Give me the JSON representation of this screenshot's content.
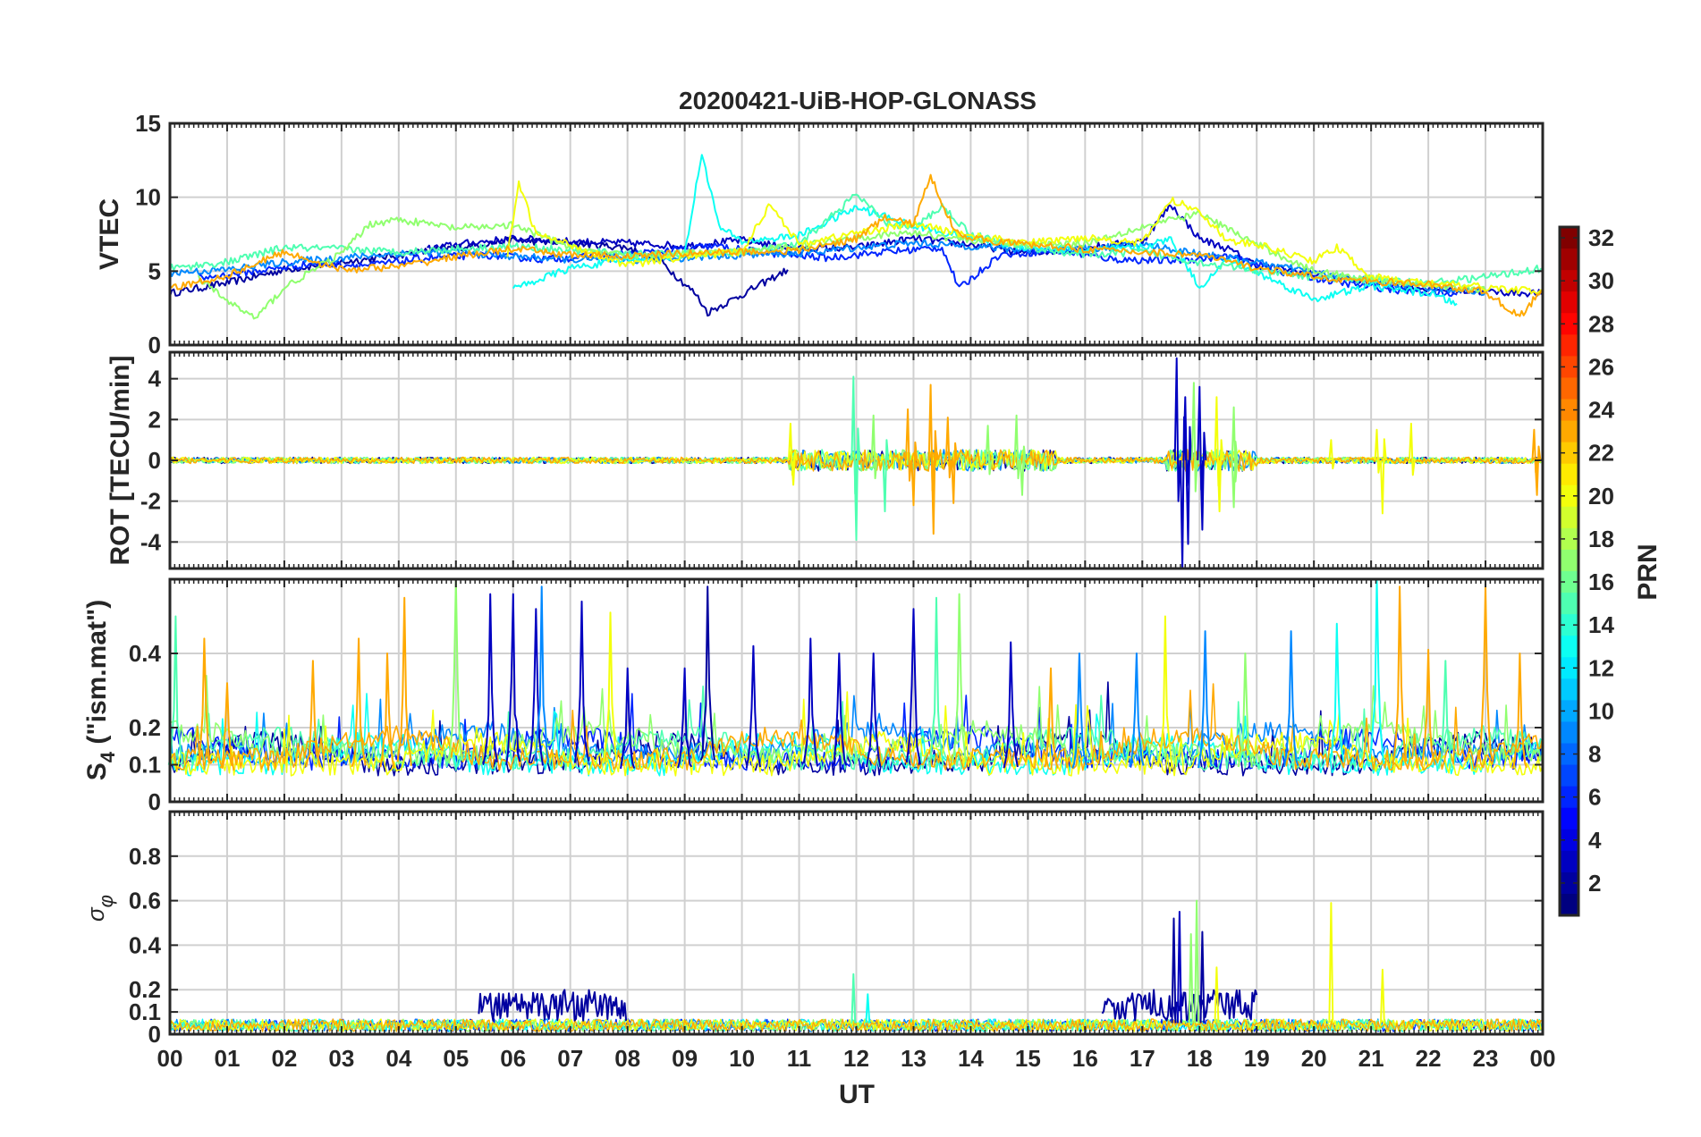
{
  "figure_title": "20200421-UiB-HOP-GLONASS",
  "colors": {
    "colormap": "jet",
    "grid": "#d0d0d0",
    "axes": "#262626",
    "background": "#ffffff"
  },
  "chart_data": [
    {
      "type": "line",
      "panel": "VTEC",
      "title": "20200421-UiB-HOP-GLONASS",
      "ylabel": "VTEC",
      "xlabel": "",
      "xlim": [
        0,
        24
      ],
      "ylim": [
        0,
        15
      ],
      "yticks": [
        0,
        5,
        10,
        15
      ],
      "xticks": [
        "00",
        "01",
        "02",
        "03",
        "04",
        "05",
        "06",
        "07",
        "08",
        "09",
        "10",
        "11",
        "12",
        "13",
        "14",
        "15",
        "16",
        "17",
        "18",
        "19",
        "20",
        "21",
        "22",
        "23",
        "00"
      ],
      "grid": true,
      "colorby": "PRN",
      "series": [
        {
          "prn": 2,
          "x": [
            0,
            1,
            2,
            3,
            4,
            5,
            6,
            7,
            8,
            8.6,
            9.2,
            9.4,
            10,
            10.8
          ],
          "y": [
            3.5,
            4.2,
            5.1,
            5.6,
            6.1,
            6.6,
            7.1,
            6.9,
            6.6,
            5.6,
            3.4,
            2.2,
            3.4,
            5.1
          ]
        },
        {
          "prn": 3,
          "x": [
            4.5,
            5,
            6,
            7,
            8,
            9,
            10,
            11,
            12,
            13,
            14,
            15,
            16,
            17,
            17.5,
            18,
            18.5,
            19,
            20,
            21,
            22,
            23,
            24
          ],
          "y": [
            6.5,
            6.8,
            7.2,
            7.0,
            6.9,
            6.7,
            7.1,
            6.5,
            6.6,
            7.2,
            6.8,
            6.2,
            6.6,
            7.0,
            9.5,
            7.2,
            6.5,
            5.4,
            4.8,
            4.2,
            3.8,
            3.6,
            3.5
          ]
        },
        {
          "prn": 6,
          "x": [
            0.5,
            1.5,
            2.5,
            3.5,
            4.5,
            5.5,
            6.5,
            7.5,
            8.5,
            9.5,
            10.5,
            11.5,
            12.5,
            13.5,
            13.8,
            14.5,
            15.5,
            16.5,
            17.5,
            18.5,
            19.5,
            20.5,
            21.5,
            22.5
          ],
          "y": [
            4.5,
            5.0,
            5.5,
            5.4,
            5.9,
            6.1,
            5.8,
            6.0,
            6.3,
            6.7,
            6.2,
            5.9,
            6.3,
            6.6,
            3.8,
            6.1,
            6.4,
            5.8,
            5.7,
            6.0,
            4.9,
            4.2,
            3.7,
            3.4
          ]
        },
        {
          "prn": 9,
          "x": [
            0,
            1,
            2,
            3,
            4,
            5,
            6,
            7,
            8,
            9,
            10,
            11,
            12,
            13,
            14,
            15,
            16,
            17,
            18,
            19,
            20,
            21,
            22,
            23
          ],
          "y": [
            4.9,
            5.1,
            5.6,
            5.9,
            6.2,
            6.3,
            6.0,
            5.8,
            5.7,
            5.9,
            6.1,
            6.2,
            6.6,
            6.9,
            6.7,
            6.4,
            6.5,
            6.8,
            6.2,
            5.6,
            4.9,
            4.3,
            3.9,
            3.6
          ]
        },
        {
          "prn": 13,
          "x": [
            6,
            6.5,
            7,
            8,
            9,
            9.3,
            9.6,
            10,
            11,
            12,
            13,
            14,
            15,
            16,
            17,
            17.5,
            18,
            18.5,
            19,
            20,
            21,
            22,
            22.5
          ],
          "y": [
            3.8,
            4.5,
            5.2,
            5.8,
            6.1,
            13.0,
            8.0,
            7.0,
            7.4,
            9.3,
            8.1,
            7.2,
            6.6,
            6.4,
            6.6,
            7.2,
            3.9,
            5.8,
            4.9,
            3.1,
            4.0,
            3.5,
            2.8
          ]
        },
        {
          "prn": 15,
          "x": [
            0,
            1,
            1.5,
            2,
            3,
            4,
            5,
            6,
            7,
            8,
            9,
            10,
            11,
            11.5,
            12,
            12.5,
            13,
            13.5,
            14,
            15,
            16,
            17,
            18,
            19,
            20,
            21,
            22,
            23,
            24
          ],
          "y": [
            5.2,
            5.6,
            6.1,
            6.6,
            6.5,
            6.3,
            6.5,
            6.7,
            6.4,
            6.2,
            6.1,
            6.3,
            6.8,
            8.5,
            10.2,
            8.3,
            7.9,
            9.4,
            7.5,
            6.6,
            6.1,
            6.3,
            5.6,
            5.0,
            4.6,
            4.4,
            4.2,
            4.6,
            5.2
          ]
        },
        {
          "prn": 17,
          "x": [
            0.5,
            1,
            1.5,
            2,
            3,
            3.5,
            4,
            5,
            6,
            7,
            8,
            9,
            10,
            11,
            12,
            13,
            14,
            15,
            16,
            17,
            18,
            19,
            20,
            21,
            22,
            23
          ],
          "y": [
            4.5,
            3.0,
            1.8,
            3.9,
            6.2,
            8.2,
            8.5,
            7.9,
            8.1,
            6.6,
            6.0,
            6.2,
            6.3,
            6.7,
            7.3,
            7.6,
            7.1,
            6.8,
            6.9,
            8.0,
            8.9,
            6.8,
            5.0,
            4.5,
            4.1,
            3.7
          ]
        },
        {
          "prn": 20,
          "x": [
            5.9,
            6.1,
            6.4,
            7,
            8,
            9,
            10,
            10.5,
            11,
            12,
            13,
            14,
            15,
            16,
            17,
            17.5,
            18,
            18.5,
            19,
            20,
            20.4,
            21,
            22,
            23,
            24
          ],
          "y": [
            6.0,
            11.0,
            7.5,
            6.8,
            5.4,
            6.0,
            6.3,
            9.6,
            6.8,
            7.6,
            8.2,
            7.4,
            6.9,
            7.3,
            6.9,
            9.8,
            9.1,
            7.0,
            6.8,
            5.7,
            6.6,
            4.6,
            4.2,
            3.9,
            3.6
          ]
        },
        {
          "prn": 23,
          "x": [
            0,
            1,
            2,
            3,
            4,
            5,
            6,
            7,
            8,
            9,
            10,
            11,
            12,
            12.5,
            13,
            13.3,
            13.7,
            14,
            15,
            16,
            17,
            18,
            19,
            20,
            21,
            22,
            23,
            23.6,
            24
          ],
          "y": [
            3.8,
            4.7,
            6.3,
            5.1,
            5.3,
            6.0,
            6.5,
            6.1,
            6.0,
            6.2,
            6.3,
            6.4,
            7.2,
            8.6,
            8.2,
            11.4,
            7.9,
            7.2,
            6.8,
            6.5,
            6.3,
            6.1,
            5.2,
            4.6,
            4.3,
            4.1,
            3.6,
            1.9,
            3.8
          ]
        }
      ]
    },
    {
      "type": "line",
      "panel": "ROT",
      "ylabel": "ROT [TECU/min]",
      "xlim": [
        0,
        24
      ],
      "ylim": [
        -5.3,
        5.3
      ],
      "yticks": [
        -4,
        -2,
        0,
        2,
        4
      ],
      "grid": true,
      "colorby": "PRN",
      "baseline_noise": 0.15,
      "spikes": [
        {
          "x": 10.85,
          "y": 1.8,
          "prn": 20
        },
        {
          "x": 10.9,
          "y": -1.2,
          "prn": 20
        },
        {
          "x": 11.95,
          "y": 4.1,
          "prn": 15
        },
        {
          "x": 12.0,
          "y": -3.9,
          "prn": 15
        },
        {
          "x": 12.3,
          "y": 2.2,
          "prn": 17
        },
        {
          "x": 12.5,
          "y": -2.5,
          "prn": 15
        },
        {
          "x": 12.9,
          "y": 2.5,
          "prn": 23
        },
        {
          "x": 13.0,
          "y": -2.2,
          "prn": 23
        },
        {
          "x": 13.3,
          "y": 3.7,
          "prn": 23
        },
        {
          "x": 13.35,
          "y": -3.6,
          "prn": 23
        },
        {
          "x": 13.6,
          "y": 2.1,
          "prn": 23
        },
        {
          "x": 13.7,
          "y": -2.1,
          "prn": 23
        },
        {
          "x": 14.3,
          "y": 1.7,
          "prn": 17
        },
        {
          "x": 14.8,
          "y": 2.2,
          "prn": 17
        },
        {
          "x": 14.9,
          "y": -1.7,
          "prn": 17
        },
        {
          "x": 17.6,
          "y": 5.0,
          "prn": 3
        },
        {
          "x": 17.7,
          "y": -5.3,
          "prn": 3
        },
        {
          "x": 17.75,
          "y": 3.1,
          "prn": 3
        },
        {
          "x": 17.8,
          "y": -4.1,
          "prn": 3
        },
        {
          "x": 18.0,
          "y": 3.6,
          "prn": 3
        },
        {
          "x": 18.05,
          "y": -3.4,
          "prn": 3
        },
        {
          "x": 17.9,
          "y": 3.8,
          "prn": 17
        },
        {
          "x": 18.3,
          "y": 3.1,
          "prn": 20
        },
        {
          "x": 18.35,
          "y": -2.5,
          "prn": 20
        },
        {
          "x": 18.6,
          "y": 2.6,
          "prn": 17
        },
        {
          "x": 18.6,
          "y": -2.3,
          "prn": 17
        },
        {
          "x": 20.3,
          "y": 1.0,
          "prn": 20
        },
        {
          "x": 21.1,
          "y": 1.5,
          "prn": 20
        },
        {
          "x": 21.2,
          "y": -2.6,
          "prn": 20
        },
        {
          "x": 21.7,
          "y": 1.8,
          "prn": 20
        },
        {
          "x": 23.85,
          "y": 1.5,
          "prn": 23
        },
        {
          "x": 23.9,
          "y": -1.7,
          "prn": 23
        }
      ]
    },
    {
      "type": "line",
      "panel": "S4",
      "ylabel": "S",
      "ylabel_subscript": "4",
      "ylabel_suffix": " (\"ism.mat\")",
      "xlim": [
        0,
        24
      ],
      "ylim": [
        0,
        0.6
      ],
      "yticks": [
        0,
        0.1,
        0.2,
        0.4
      ],
      "grid": true,
      "colorby": "PRN",
      "baseline": 0.07,
      "spikes": [
        {
          "x": 0.1,
          "y": 0.5,
          "prn": 15
        },
        {
          "x": 0.6,
          "y": 0.44,
          "prn": 23
        },
        {
          "x": 1.0,
          "y": 0.32,
          "prn": 23
        },
        {
          "x": 2.5,
          "y": 0.38,
          "prn": 23
        },
        {
          "x": 3.3,
          "y": 0.44,
          "prn": 23
        },
        {
          "x": 3.8,
          "y": 0.4,
          "prn": 23
        },
        {
          "x": 4.1,
          "y": 0.55,
          "prn": 23
        },
        {
          "x": 5.0,
          "y": 0.6,
          "prn": 17
        },
        {
          "x": 5.6,
          "y": 0.56,
          "prn": 3
        },
        {
          "x": 6.0,
          "y": 0.56,
          "prn": 3
        },
        {
          "x": 6.4,
          "y": 0.52,
          "prn": 3
        },
        {
          "x": 6.5,
          "y": 0.58,
          "prn": 9
        },
        {
          "x": 7.2,
          "y": 0.54,
          "prn": 3
        },
        {
          "x": 7.7,
          "y": 0.51,
          "prn": 20
        },
        {
          "x": 8.0,
          "y": 0.36,
          "prn": 3
        },
        {
          "x": 9.0,
          "y": 0.36,
          "prn": 3
        },
        {
          "x": 9.4,
          "y": 0.58,
          "prn": 2
        },
        {
          "x": 10.2,
          "y": 0.42,
          "prn": 3
        },
        {
          "x": 11.2,
          "y": 0.44,
          "prn": 3
        },
        {
          "x": 11.7,
          "y": 0.4,
          "prn": 3
        },
        {
          "x": 12.3,
          "y": 0.4,
          "prn": 3
        },
        {
          "x": 13.0,
          "y": 0.52,
          "prn": 3
        },
        {
          "x": 13.4,
          "y": 0.55,
          "prn": 15
        },
        {
          "x": 13.8,
          "y": 0.56,
          "prn": 17
        },
        {
          "x": 14.7,
          "y": 0.43,
          "prn": 3
        },
        {
          "x": 15.4,
          "y": 0.36,
          "prn": 23
        },
        {
          "x": 15.9,
          "y": 0.4,
          "prn": 9
        },
        {
          "x": 16.9,
          "y": 0.4,
          "prn": 9
        },
        {
          "x": 17.4,
          "y": 0.5,
          "prn": 20
        },
        {
          "x": 18.1,
          "y": 0.46,
          "prn": 9
        },
        {
          "x": 18.8,
          "y": 0.4,
          "prn": 17
        },
        {
          "x": 19.6,
          "y": 0.46,
          "prn": 9
        },
        {
          "x": 20.4,
          "y": 0.48,
          "prn": 13
        },
        {
          "x": 21.1,
          "y": 0.6,
          "prn": 13
        },
        {
          "x": 21.5,
          "y": 0.58,
          "prn": 23
        },
        {
          "x": 22.0,
          "y": 0.41,
          "prn": 23
        },
        {
          "x": 22.3,
          "y": 0.38,
          "prn": 15
        },
        {
          "x": 23.0,
          "y": 0.58,
          "prn": 23
        },
        {
          "x": 23.6,
          "y": 0.4,
          "prn": 23
        }
      ]
    },
    {
      "type": "line",
      "panel": "sigma_phi",
      "ylabel": "σ",
      "ylabel_subscript": "φ",
      "xlabel": "UT",
      "xlim": [
        0,
        24
      ],
      "ylim": [
        0,
        1
      ],
      "yticks": [
        0,
        0.1,
        0.2,
        0.4,
        0.6,
        0.8
      ],
      "grid": true,
      "colorby": "PRN",
      "baseline": 0.04,
      "bursts": [
        {
          "x0": 5.4,
          "x1": 8.0,
          "amp": 0.2,
          "prn": 2
        },
        {
          "x0": 16.3,
          "x1": 19.0,
          "amp": 0.2,
          "prn": 2
        }
      ],
      "spikes": [
        {
          "x": 11.95,
          "y": 0.27,
          "prn": 15
        },
        {
          "x": 12.2,
          "y": 0.18,
          "prn": 13
        },
        {
          "x": 17.55,
          "y": 0.52,
          "prn": 2
        },
        {
          "x": 17.65,
          "y": 0.55,
          "prn": 3
        },
        {
          "x": 17.85,
          "y": 0.45,
          "prn": 17
        },
        {
          "x": 17.95,
          "y": 0.6,
          "prn": 17
        },
        {
          "x": 18.05,
          "y": 0.46,
          "prn": 2
        },
        {
          "x": 18.3,
          "y": 0.3,
          "prn": 20
        },
        {
          "x": 20.3,
          "y": 0.59,
          "prn": 20
        },
        {
          "x": 21.2,
          "y": 0.29,
          "prn": 20
        }
      ]
    }
  ],
  "colorbar": {
    "label": "PRN",
    "min": 1,
    "max": 32,
    "ticks": [
      2,
      4,
      6,
      8,
      10,
      12,
      14,
      16,
      18,
      20,
      22,
      24,
      26,
      28,
      30,
      32
    ]
  }
}
